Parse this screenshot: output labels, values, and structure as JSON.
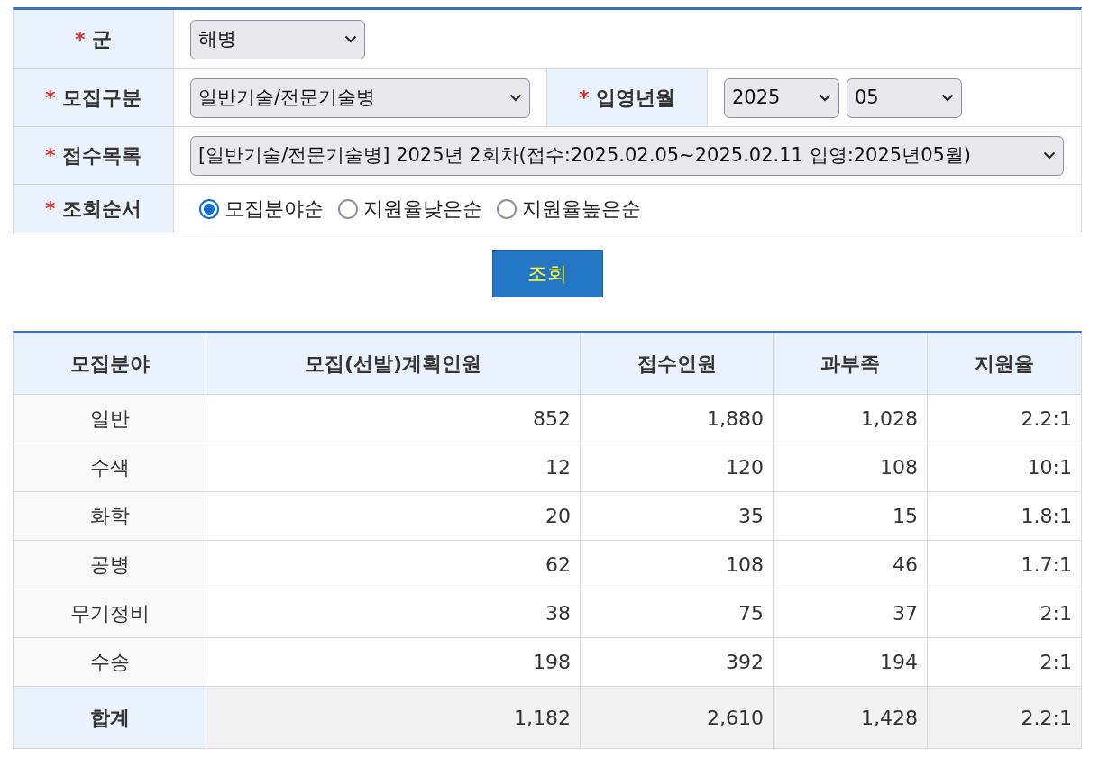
{
  "form": {
    "branch": {
      "mark": "*",
      "label": "군",
      "value": "해병"
    },
    "recruit_type": {
      "mark": "*",
      "label": "모집구분",
      "value": "일반기술/전문기술병"
    },
    "enlist_month": {
      "mark": "*",
      "label": "입영년월",
      "year": "2025",
      "month": "05"
    },
    "intake_list": {
      "mark": "*",
      "label": "접수목록",
      "value": "[일반기술/전문기술병] 2025년 2회차(접수:2025.02.05~2025.02.11 입영:2025년05월)"
    },
    "sort_order": {
      "mark": "*",
      "label": "조회순서",
      "options": [
        {
          "label": "모집분야순",
          "selected": true
        },
        {
          "label": "지원율낮은순",
          "selected": false
        },
        {
          "label": "지원율높은순",
          "selected": false
        }
      ]
    }
  },
  "search_button": "조회",
  "table": {
    "columns": [
      "모집분야",
      "모집(선발)계획인원",
      "접수인원",
      "과부족",
      "지원율"
    ],
    "rows": [
      [
        "일반",
        "852",
        "1,880",
        "1,028",
        "2.2:1"
      ],
      [
        "수색",
        "12",
        "120",
        "108",
        "10:1"
      ],
      [
        "화학",
        "20",
        "35",
        "15",
        "1.8:1"
      ],
      [
        "공병",
        "62",
        "108",
        "46",
        "1.7:1"
      ],
      [
        "무기정비",
        "38",
        "75",
        "37",
        "2:1"
      ],
      [
        "수송",
        "198",
        "392",
        "194",
        "2:1"
      ]
    ],
    "total": [
      "합계",
      "1,182",
      "2,610",
      "1,428",
      "2.2:1"
    ]
  }
}
